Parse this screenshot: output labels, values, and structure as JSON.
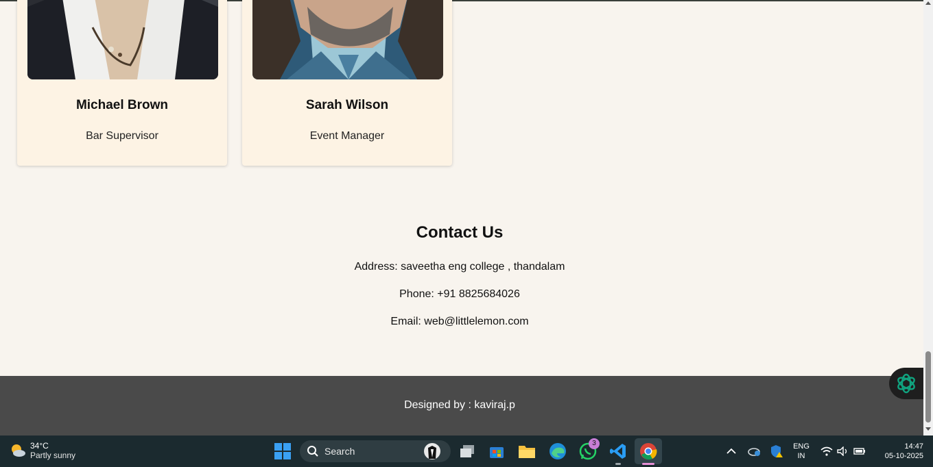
{
  "team": [
    {
      "name": "Michael Brown",
      "role": "Bar Supervisor"
    },
    {
      "name": "Sarah Wilson",
      "role": "Event Manager"
    }
  ],
  "contact": {
    "title": "Contact Us",
    "address": "Address: saveetha eng college , thandalam",
    "phone": "Phone: +91 8825684026",
    "email": "Email: web@littlelemon.com"
  },
  "footer": {
    "text": "Designed by : kaviraj.p"
  },
  "taskbar": {
    "weather_temp": "34°C",
    "weather_condition": "Partly sunny",
    "search_placeholder": "Search",
    "whatsapp_badge": "3",
    "language_line1": "ENG",
    "language_line2": "IN",
    "time": "14:47",
    "date": "05-10-2025"
  },
  "colors": {
    "page_bg": "#f8f4ee",
    "card_bg": "#fdf3e4",
    "footer_bg": "#4a4a4a",
    "taskbar_bg": "#1b2a2f",
    "chatgpt_green": "#10a37f"
  }
}
